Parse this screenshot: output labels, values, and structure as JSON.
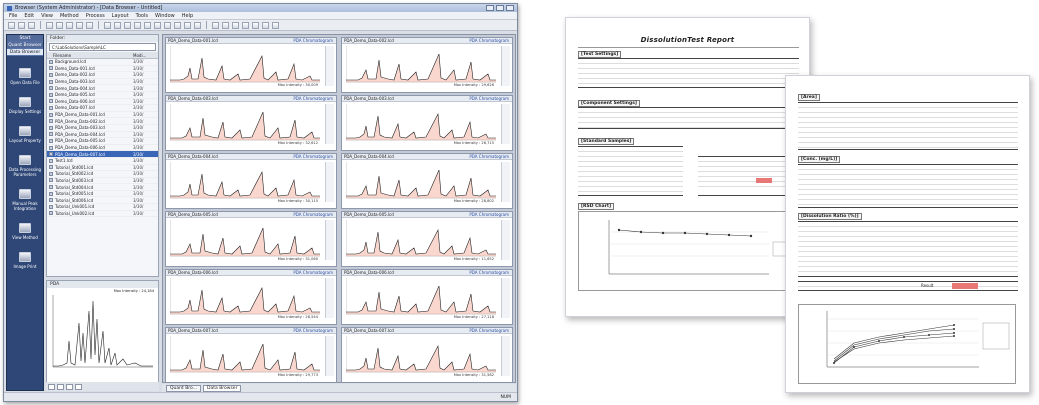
{
  "app": {
    "title": "Browser (System Administrator) - [Data Browser - Untitled]",
    "menu": [
      "File",
      "Edit",
      "View",
      "Method",
      "Process",
      "Layout",
      "Tools",
      "Window",
      "Help"
    ]
  },
  "sidebar": {
    "tabs": [
      "Start",
      "Quant Browser",
      "Data Browser"
    ],
    "items": [
      "Open Data File",
      "Display Settings",
      "Layout Property",
      "Data Processing Parameters",
      "Manual Peak Integration",
      "View Method",
      "Image Print"
    ]
  },
  "folder": {
    "label": "Folder:",
    "path": "C:\\LabSolutions\\Sample\\LC",
    "columns": [
      "Filename",
      "Modi..."
    ],
    "files": [
      {
        "name": "Background.lcd",
        "date": "3/30/"
      },
      {
        "name": "Demo_Data-001.lcd",
        "date": "3/30/"
      },
      {
        "name": "Demo_Data-002.lcd",
        "date": "3/30/"
      },
      {
        "name": "Demo_Data-003.lcd",
        "date": "3/30/"
      },
      {
        "name": "Demo_Data-004.lcd",
        "date": "3/30/"
      },
      {
        "name": "Demo_Data-005.lcd",
        "date": "3/30/"
      },
      {
        "name": "Demo_Data-006.lcd",
        "date": "3/30/"
      },
      {
        "name": "Demo_Data-007.lcd",
        "date": "3/30/"
      },
      {
        "name": "PDA_Demo_Data-001.lcd",
        "date": "3/30/"
      },
      {
        "name": "PDA_Demo_Data-002.lcd",
        "date": "3/30/"
      },
      {
        "name": "PDA_Demo_Data-003.lcd",
        "date": "3/30/"
      },
      {
        "name": "PDA_Demo_Data-004.lcd",
        "date": "3/30/"
      },
      {
        "name": "PDA_Demo_Data-005.lcd",
        "date": "3/30/"
      },
      {
        "name": "PDA_Demo_Data-006.lcd",
        "date": "3/30/"
      },
      {
        "name": "PDA_Demo_Data-007.lcd",
        "date": "3/30/"
      },
      {
        "name": "Test1.lcd",
        "date": "3/30/"
      },
      {
        "name": "Tutorial_Std001.lcd",
        "date": "3/30/"
      },
      {
        "name": "Tutorial_Std002.lcd",
        "date": "3/30/"
      },
      {
        "name": "Tutorial_Std003.lcd",
        "date": "3/30/"
      },
      {
        "name": "Tutorial_Std004.lcd",
        "date": "3/30/"
      },
      {
        "name": "Tutorial_Std005.lcd",
        "date": "3/30/"
      },
      {
        "name": "Tutorial_Std006.lcd",
        "date": "3/30/"
      },
      {
        "name": "Tutorial_Unk001.lcd",
        "date": "3/30/"
      },
      {
        "name": "Tutorial_Unk002.lcd",
        "date": "3/30/"
      }
    ],
    "selected_index": 14
  },
  "pda": {
    "label": "PDA",
    "max_intensity": "Max Intensity : 24,184"
  },
  "grid": {
    "cells": [
      {
        "name": "PDA_Demo_Data-001.lcd",
        "type": "PDA Chromatogram",
        "mi": "Max Intensity : 30,009"
      },
      {
        "name": "PDA_Demo_Data-002.lcd",
        "type": "PDA Chromatogram",
        "mi": "Max Intensity : 29,626"
      },
      {
        "name": "PDA_Demo_Data-003.lcd",
        "type": "PDA Chromatogram",
        "mi": "Max Intensity : 32,612"
      },
      {
        "name": "PDA_Demo_Data-003.lcd",
        "type": "PDA Chromatogram",
        "mi": "Max Intensity : 26,715"
      },
      {
        "name": "PDA_Demo_Data-004.lcd",
        "type": "PDA Chromatogram",
        "mi": "Max Intensity : 30,115"
      },
      {
        "name": "PDA_Demo_Data-004.lcd",
        "type": "PDA Chromatogram",
        "mi": "Max Intensity : 28,802"
      },
      {
        "name": "PDA_Demo_Data-005.lcd",
        "type": "PDA Chromatogram",
        "mi": "Max Intensity : 31,060"
      },
      {
        "name": "PDA_Demo_Data-005.lcd",
        "type": "PDA Chromatogram",
        "mi": "Max Intensity : 11,652"
      },
      {
        "name": "PDA_Demo_Data-006.lcd",
        "type": "PDA Chromatogram",
        "mi": "Max Intensity : 28,544"
      },
      {
        "name": "PDA_Demo_Data-006.lcd",
        "type": "PDA Chromatogram",
        "mi": "Max Intensity : 27,118"
      },
      {
        "name": "PDA_Demo_Data-007.lcd",
        "type": "PDA Chromatogram",
        "mi": "Max Intensity : 29,773"
      },
      {
        "name": "PDA_Demo_Data-007.lcd",
        "type": "PDA Chromatogram",
        "mi": "Max Intensity : 31,582"
      }
    ],
    "tabs": [
      "Quant Bro...",
      "Data Browser"
    ]
  },
  "status": "NUM",
  "report": {
    "title": "DissolutionTest Report",
    "sections_p1": [
      "[Test Settings]",
      "[Component Settings]",
      "[Standard Samples]",
      "[RSD Chart]"
    ],
    "sections_p2": [
      "[Area]",
      "[Conc. (mg/L)]",
      "[Dissolution Ratio (%)]"
    ],
    "judgment_label": "Result",
    "colors": {
      "highlight": "#e77876",
      "accent": "#2b50a5"
    }
  }
}
